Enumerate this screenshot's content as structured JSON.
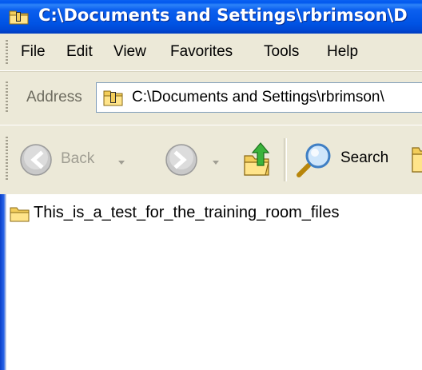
{
  "window": {
    "title": "C:\\Documents and Settings\\rbrimson\\D"
  },
  "menu": {
    "items": [
      "File",
      "Edit",
      "View",
      "Favorites",
      "Tools",
      "Help"
    ]
  },
  "address": {
    "label": "Address",
    "value": "C:\\Documents and Settings\\rbrimson\\"
  },
  "toolbar": {
    "back_label": "Back",
    "search_label": "Search"
  },
  "files": [
    {
      "name": "This_is_a_test_for_the_training_room_files",
      "icon": "folder-icon"
    }
  ],
  "colors": {
    "titlebar": "#0053e4",
    "chrome": "#ece9d8",
    "folder": "#f5d266"
  }
}
